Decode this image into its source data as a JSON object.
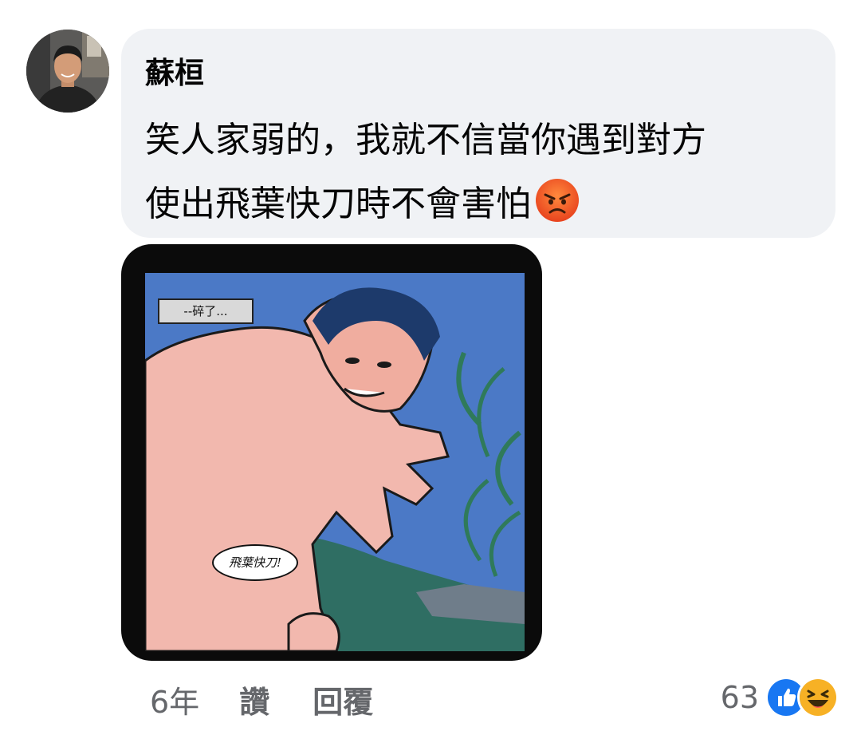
{
  "comment": {
    "author": "蘇桓",
    "text_line1": "笑人家弱的，我就不信當你遇到對方",
    "text_line2": "使出飛葉快刀時不會害怕",
    "inline_emoji": "pouting-face-icon"
  },
  "attachment": {
    "caption_text": "--碎了...",
    "speech_text": "飛葉快刀!",
    "colors": {
      "sky": "#4b79c6",
      "ground": "#2f6e63",
      "skin": "#f2b8ae"
    }
  },
  "actions": {
    "time": "6年",
    "like_label": "讚",
    "reply_label": "回覆"
  },
  "reactions": {
    "count": "63",
    "icons": [
      "like-reaction-icon",
      "haha-reaction-icon"
    ],
    "colors": {
      "like": "#1877f2",
      "haha": "#f7b125"
    }
  }
}
